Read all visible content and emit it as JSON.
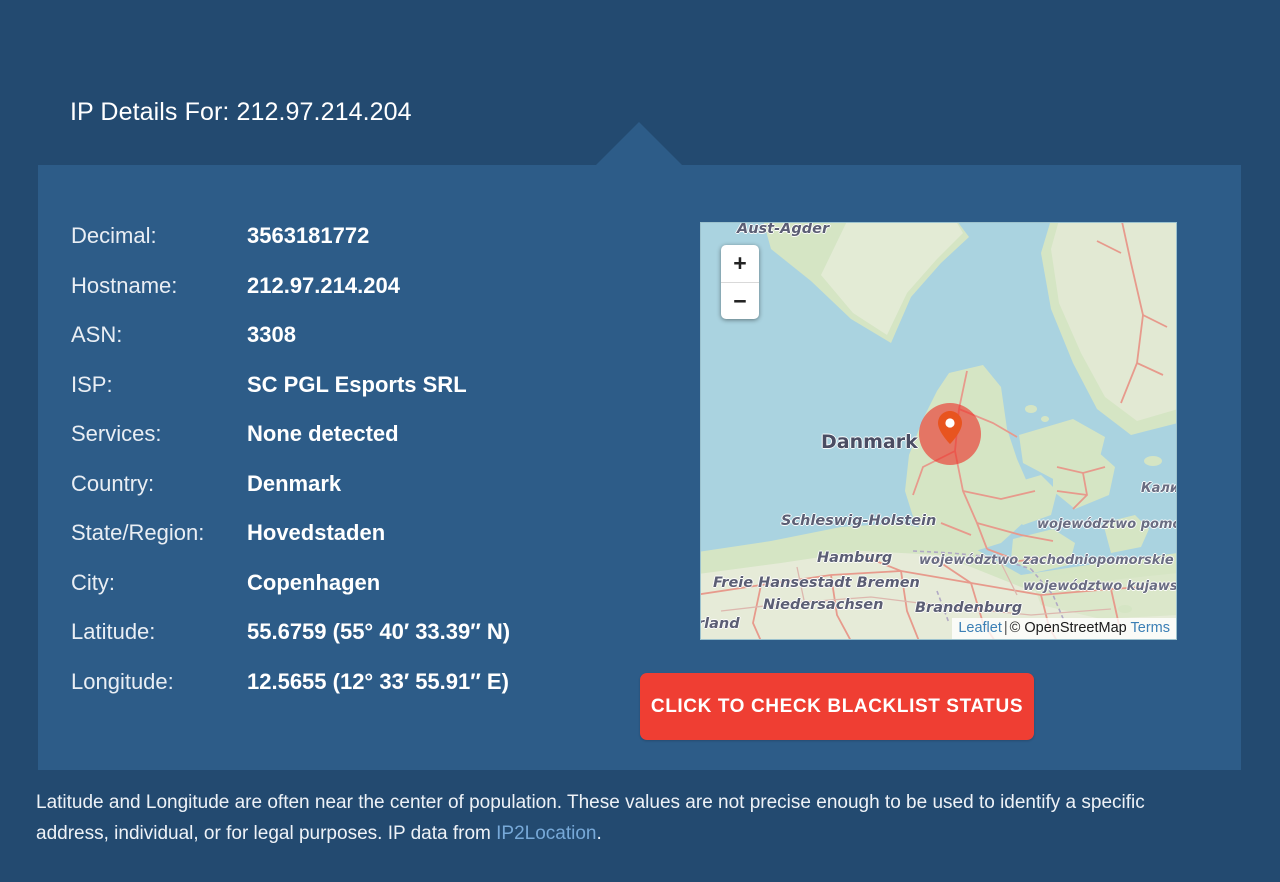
{
  "header": {
    "title_prefix": "IP Details For:",
    "ip_address": "212.97.214.204"
  },
  "details": [
    {
      "label": "Decimal:",
      "value": "3563181772"
    },
    {
      "label": "Hostname:",
      "value": "212.97.214.204"
    },
    {
      "label": "ASN:",
      "value": "3308"
    },
    {
      "label": "ISP:",
      "value": "SC PGL Esports SRL"
    },
    {
      "label": "Services:",
      "value": "None detected"
    },
    {
      "label": "Country:",
      "value": "Denmark"
    },
    {
      "label": "State/Region:",
      "value": "Hovedstaden"
    },
    {
      "label": "City:",
      "value": "Copenhagen"
    },
    {
      "label": "Latitude:",
      "value": "55.6759 (55° 40′ 33.39″ N)"
    },
    {
      "label": "Longitude:",
      "value": "12.5655 (12° 33′ 55.91″ E)"
    }
  ],
  "map": {
    "zoom_in_label": "+",
    "zoom_out_label": "−",
    "marker_title": "Copenhagen",
    "attribution": {
      "leaflet": "Leaflet",
      "separator": "|",
      "copyright": "© OpenStreetMap",
      "terms": "Terms"
    },
    "labels": [
      {
        "text": "Aust-Agder",
        "style": "region"
      },
      {
        "text": "Danmark",
        "style": "country"
      },
      {
        "text": "Schleswig-Holstein",
        "style": "region"
      },
      {
        "text": "Hamburg",
        "style": "region"
      },
      {
        "text": "Freie Hansestadt Bremen",
        "style": "region"
      },
      {
        "text": "Niedersachsen",
        "style": "region"
      },
      {
        "text": "Brandenburg",
        "style": "region"
      },
      {
        "text": "rland",
        "style": "region"
      },
      {
        "text": "województwo zachodniopomorskie",
        "style": "region-lite"
      },
      {
        "text": "województwo pomo",
        "style": "region-lite"
      },
      {
        "text": "województwo kujawsk",
        "style": "region-lite"
      },
      {
        "text": "Кали",
        "style": "region-lite"
      }
    ]
  },
  "cta": {
    "label": "CLICK TO CHECK BLACKLIST STATUS"
  },
  "footer": {
    "text_before_link": "Latitude and Longitude are often near the center of population. These values are not precise enough to be used to identify a specific address, individual, or for legal purposes. IP data from ",
    "link_text": "IP2Location",
    "text_after_link": "."
  },
  "colors": {
    "background": "#234a70",
    "panel": "#2d5c88",
    "cta": "#ef3e33",
    "link": "#77a9d8",
    "map_water": "#aad3e0",
    "map_land": "#f2efe9",
    "marker": "#ed3028"
  }
}
